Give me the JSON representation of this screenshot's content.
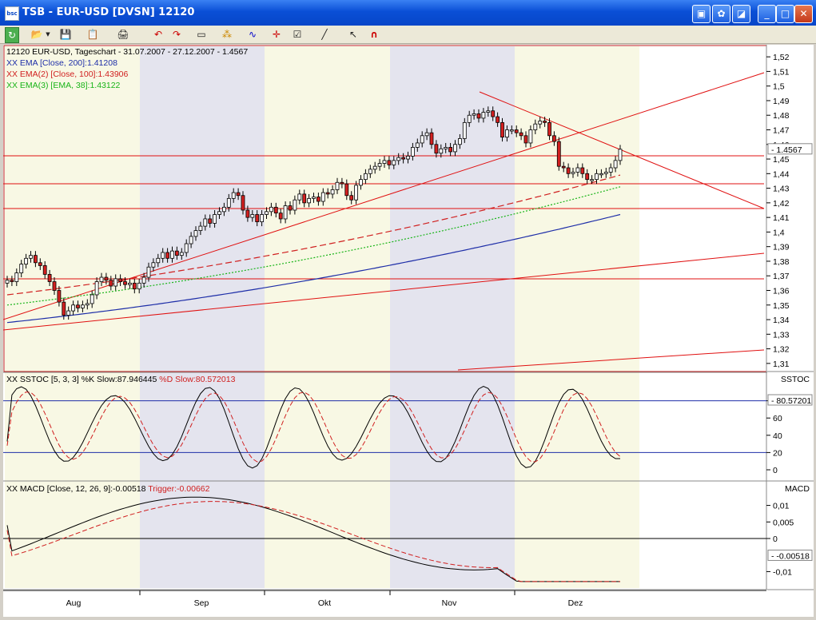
{
  "window": {
    "title": "TSB - EUR-USD [DVSN] 12120",
    "icon_text": "bsc"
  },
  "title_buttons": [
    "▣",
    "✿",
    "◪",
    "_",
    "□",
    "✕"
  ],
  "colors": {
    "candle_up": "#ffffff",
    "candle_down": "#d42020",
    "ema200": "#1e2ea8",
    "ema100": "#d02020",
    "ema38": "#18b418",
    "stoch_k": "#000000",
    "stoch_d": "#d02020",
    "trend": "#e01010",
    "band_grey": "#e4e4ee",
    "band_cream": "#f8f8e4"
  },
  "legend": {
    "series_title": "12120  EUR-USD, Tageschart - 31.07.2007 - 27.12.2007 - 1.4567",
    "ema200": "XX EMA [Close, 200]:1.41208",
    "ema100": "XX EMA(2) [Close, 100]:1.43906",
    "ema38": "XX EMA(3) [EMA, 38]:1.43122"
  },
  "stoch_legend": {
    "prefix": "XX SSTOC [5, 3, 3] %K Slow:87.946445",
    "d": "%D Slow:80.572013",
    "panel_label": "SSTOC",
    "current": "80.57201"
  },
  "macd_legend": {
    "prefix": "XX MACD [Close, 12, 26, 9]:-0.00518",
    "trigger": "Trigger:-0.00662",
    "panel_label": "MACD",
    "current": "-0.00518"
  },
  "price_axis": {
    "current": "1.4567",
    "ticks": [
      "1,52",
      "1,51",
      "1,5",
      "1,49",
      "1,48",
      "1,47",
      "1,46",
      "1,45",
      "1,44",
      "1,43",
      "1,42",
      "1,41",
      "1,4",
      "1,39",
      "1,38",
      "1,37",
      "1,36",
      "1,35",
      "1,34",
      "1,33",
      "1,32",
      "1,31"
    ]
  },
  "stoch_axis": {
    "ticks": [
      "80",
      "60",
      "40",
      "20",
      "0"
    ]
  },
  "macd_axis": {
    "ticks": [
      "0,01",
      "0,005",
      "0",
      "-0,01"
    ]
  },
  "months": [
    "Aug",
    "Sep",
    "Okt",
    "Nov",
    "Dez"
  ],
  "chart_data": {
    "type": "candlestick",
    "title": "12120  EUR-USD, Tageschart - 31.07.2007 - 27.12.2007 - 1.4567",
    "ylim": [
      1.305,
      1.525
    ],
    "closes": [
      1.367,
      1.366,
      1.372,
      1.378,
      1.382,
      1.384,
      1.379,
      1.377,
      1.371,
      1.366,
      1.36,
      1.352,
      1.343,
      1.346,
      1.35,
      1.348,
      1.35,
      1.351,
      1.357,
      1.366,
      1.369,
      1.367,
      1.363,
      1.368,
      1.366,
      1.364,
      1.365,
      1.361,
      1.365,
      1.369,
      1.376,
      1.379,
      1.382,
      1.386,
      1.382,
      1.387,
      1.384,
      1.386,
      1.392,
      1.397,
      1.401,
      1.404,
      1.409,
      1.406,
      1.412,
      1.414,
      1.417,
      1.423,
      1.427,
      1.425,
      1.415,
      1.41,
      1.412,
      1.407,
      1.412,
      1.414,
      1.417,
      1.413,
      1.409,
      1.418,
      1.415,
      1.422,
      1.426,
      1.42,
      1.423,
      1.424,
      1.421,
      1.427,
      1.426,
      1.429,
      1.434,
      1.433,
      1.425,
      1.422,
      1.432,
      1.436,
      1.44,
      1.443,
      1.445,
      1.447,
      1.449,
      1.446,
      1.449,
      1.451,
      1.45,
      1.452,
      1.458,
      1.461,
      1.466,
      1.468,
      1.46,
      1.454,
      1.457,
      1.458,
      1.455,
      1.46,
      1.464,
      1.475,
      1.48,
      1.481,
      1.478,
      1.482,
      1.483,
      1.479,
      1.475,
      1.465,
      1.47,
      1.47,
      1.468,
      1.466,
      1.461,
      1.47,
      1.474,
      1.476,
      1.475,
      1.466,
      1.462,
      1.445,
      1.444,
      1.44,
      1.441,
      1.444,
      1.44,
      1.436,
      1.436,
      1.44,
      1.44,
      1.441,
      1.444,
      1.449,
      1.4567
    ],
    "ema200": [
      1.338,
      1.412
    ],
    "ema100": [
      1.357,
      1.439
    ],
    "ema38": [
      1.35,
      1.431
    ],
    "stoch_k_start": 33,
    "stoch_d_start": 28,
    "macd_start": 0.004,
    "trigger_start": 0.0025
  }
}
